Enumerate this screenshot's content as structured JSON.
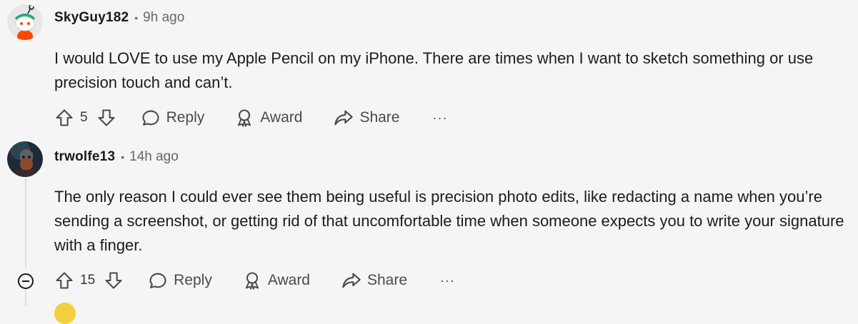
{
  "comments": [
    {
      "username": "SkyGuy182",
      "separator": "•",
      "time": "9h ago",
      "body": "I would LOVE to use my Apple Pencil on my iPhone. There are times when I want to sketch something or use precision touch and can’t.",
      "votes": "5",
      "reply_label": "Reply",
      "award_label": "Award",
      "share_label": "Share",
      "more_label": "···",
      "avatar_icon": "snoo-avatar-icon"
    },
    {
      "username": "trwolfe13",
      "separator": "•",
      "time": "14h ago",
      "body": "The only reason I could ever see them being useful is precision photo edits, like redacting a name when you’re sending a screenshot, or getting rid of that uncomfortable time when someone expects you to write your signature with a finger.",
      "votes": "15",
      "reply_label": "Reply",
      "award_label": "Award",
      "share_label": "Share",
      "more_label": "···",
      "avatar_icon": "photo-avatar-icon"
    }
  ],
  "colors": {
    "background": "#f5f5f5",
    "text": "#1c1c1c",
    "muted": "#666666",
    "thread_line": "#dedede"
  }
}
